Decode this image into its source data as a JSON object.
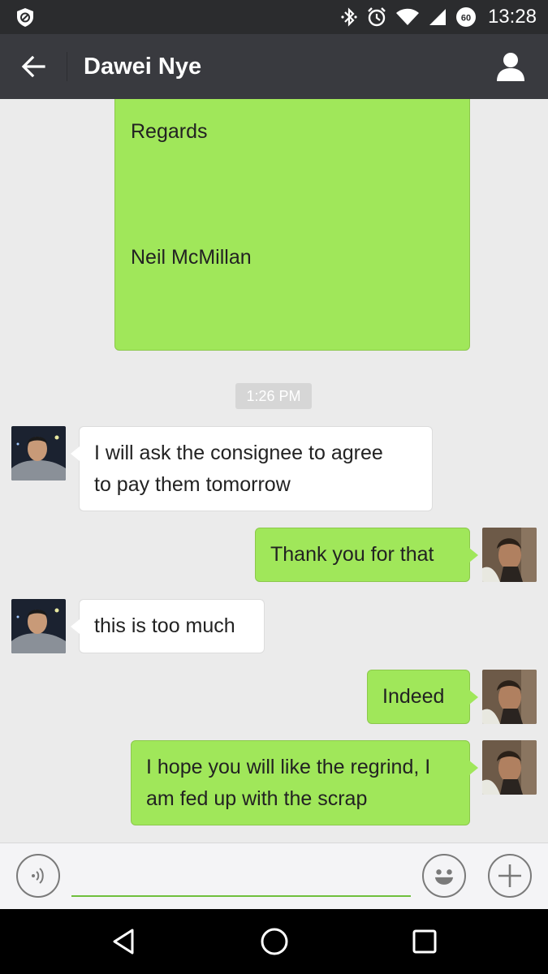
{
  "status_bar": {
    "time": "13:28",
    "battery_level": "60",
    "icons": [
      "vpn-shield-icon",
      "bluetooth-icon",
      "alarm-icon",
      "wifi-icon",
      "cell-signal-icon",
      "battery-icon"
    ]
  },
  "header": {
    "title": "Dawei Nye",
    "back_icon": "arrow-left-icon",
    "profile_icon": "person-icon"
  },
  "colors": {
    "header_bg": "#393a3f",
    "status_bg": "#2b2c2e",
    "chat_bg": "#ebebeb",
    "sent_bubble": "#a0e75a",
    "received_bubble": "#ffffff",
    "input_underline": "#6fbf3d"
  },
  "messages": {
    "letter_line_1": "Regards",
    "letter_line_2": "Neil McMillan",
    "timestamp": "1:26 PM",
    "m1_line1": "I will ask the consignee to agree",
    "m1_line2": "to pay them tomorrow",
    "m2": "Thank you for that",
    "m3": "this is too much",
    "m4": "Indeed",
    "m5_line1": "I hope you will like the regrind, I",
    "m5_line2": "am fed up with the scrap"
  },
  "input_bar": {
    "voice_icon": "voice-input-icon",
    "emoji_icon": "emoji-icon",
    "more_icon": "plus-icon",
    "value": ""
  },
  "nav_bar": {
    "icons": [
      "back-triangle-icon",
      "home-circle-icon",
      "recents-square-icon"
    ]
  }
}
